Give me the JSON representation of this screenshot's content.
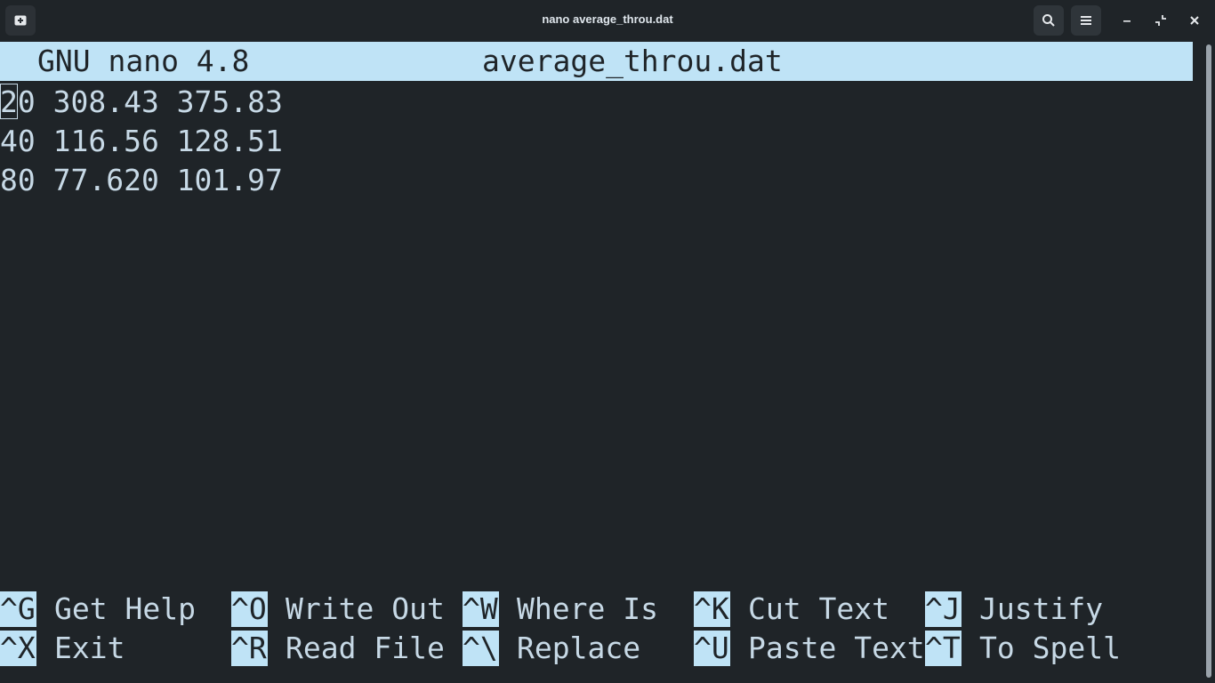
{
  "window": {
    "title": "nano average_throu.dat"
  },
  "icons": {
    "new_tab": "new-tab-icon",
    "search": "search-icon",
    "menu": "hamburger-menu-icon",
    "minimize": "minimize-icon",
    "restore": "restore-icon",
    "close": "close-icon"
  },
  "nano": {
    "version": "GNU nano 4.8",
    "filename": "average_throu.dat",
    "lines": [
      "20 308.43 375.83",
      "40 116.56 128.51",
      "80 77.620 101.97"
    ],
    "shortcuts_row1": [
      {
        "key": "^G",
        "label": "Get Help"
      },
      {
        "key": "^O",
        "label": "Write Out"
      },
      {
        "key": "^W",
        "label": "Where Is"
      },
      {
        "key": "^K",
        "label": "Cut Text"
      },
      {
        "key": "^J",
        "label": "Justify"
      }
    ],
    "shortcuts_row2": [
      {
        "key": "^X",
        "label": "Exit"
      },
      {
        "key": "^R",
        "label": "Read File"
      },
      {
        "key": "^\\",
        "label": "Replace"
      },
      {
        "key": "^U",
        "label": "Paste Text"
      },
      {
        "key": "^T",
        "label": "To Spell"
      }
    ]
  },
  "colors": {
    "background": "#1f2428",
    "foreground": "#c7d9e6",
    "highlight": "#bfe3f6"
  }
}
